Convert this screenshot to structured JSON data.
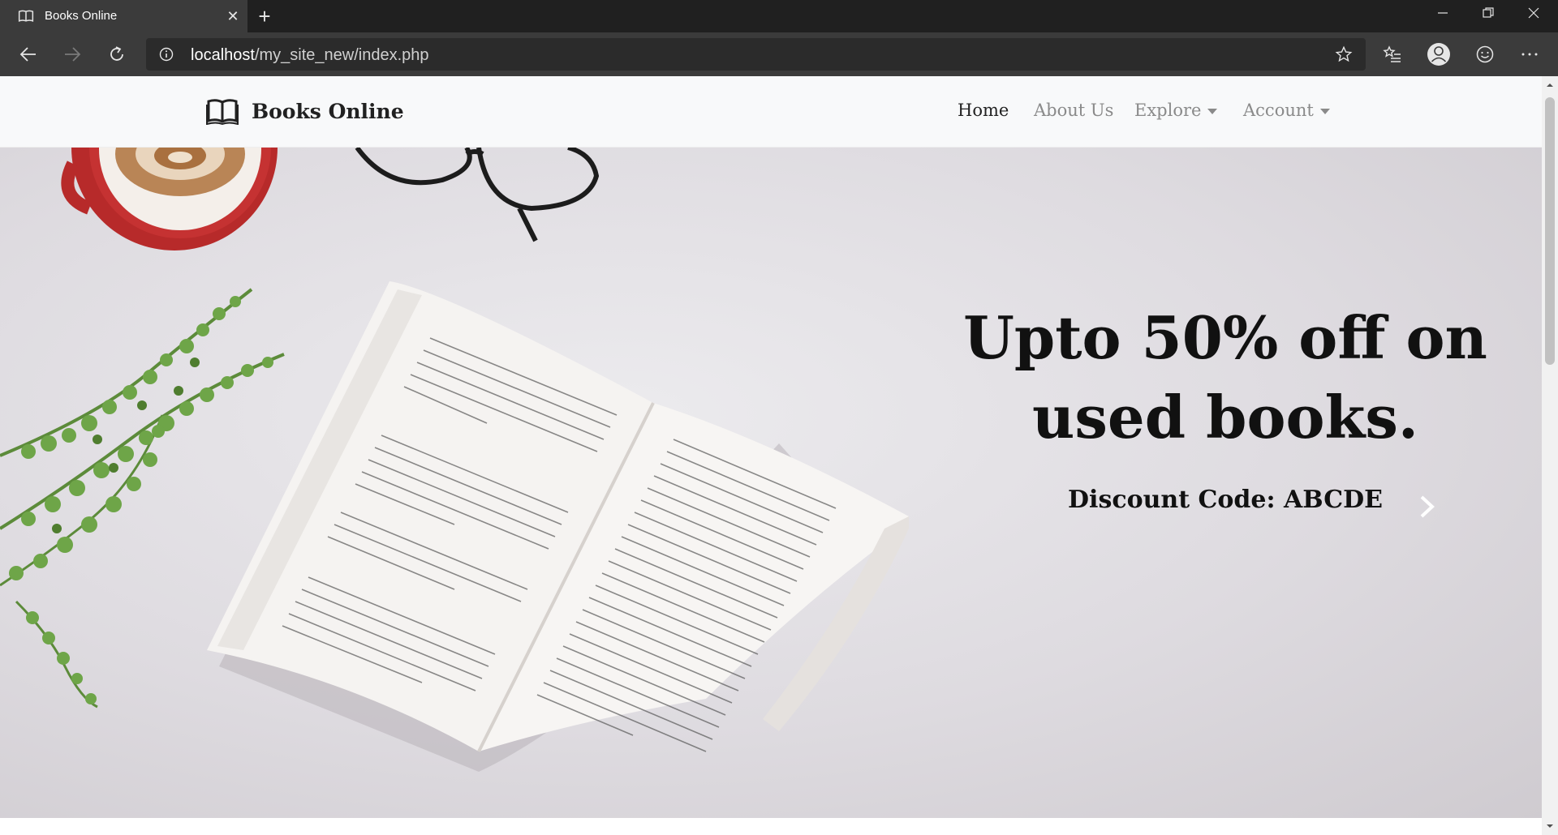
{
  "browser": {
    "tab_title": "Books Online",
    "url_host": "localhost",
    "url_path": "/my_site_new/index.php"
  },
  "site": {
    "brand_name": "Books Online",
    "nav": [
      {
        "label": "Home",
        "active": true
      },
      {
        "label": "About Us",
        "active": false
      },
      {
        "label": "Explore",
        "active": false,
        "dropdown": true
      },
      {
        "label": "Account",
        "active": false,
        "dropdown": true
      }
    ]
  },
  "hero": {
    "headline_line1": "Upto 50% off on",
    "headline_line2": "used books.",
    "subtitle": "Discount Code: ABCDE",
    "slides": 3,
    "active_slide": 2
  },
  "icons": {
    "tab": "book-open-icon",
    "brand": "book-open-icon",
    "back": "arrow-left-icon",
    "forward": "arrow-right-icon",
    "refresh": "refresh-icon",
    "info": "info-icon",
    "favorite": "star-icon",
    "favorites_list": "favorites-list-icon",
    "profile": "profile-icon",
    "feedback": "smiley-icon",
    "more": "more-icon",
    "carousel_next": "chevron-right-icon"
  }
}
